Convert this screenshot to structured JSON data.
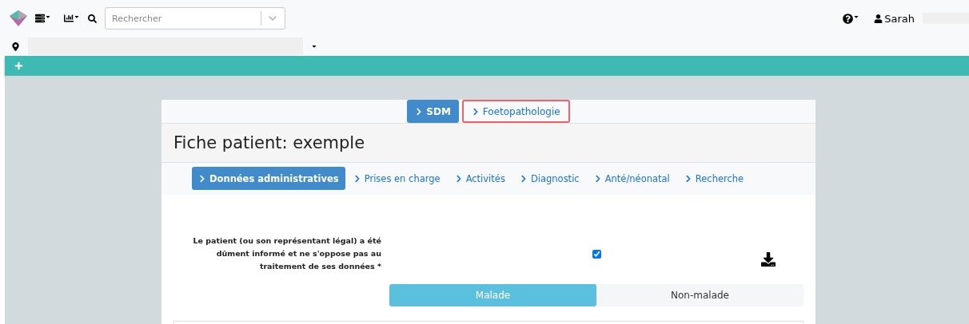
{
  "navbar": {
    "search": {
      "placeholder": "Rechercher"
    },
    "user": {
      "name": "Sarah"
    }
  },
  "modules": [
    {
      "label": "SDM",
      "selected": true,
      "highlighted": false
    },
    {
      "label": "Foetopathologie",
      "selected": false,
      "highlighted": true
    }
  ],
  "page": {
    "title": "Fiche patient: exemple"
  },
  "tabs": [
    {
      "label": "Données administratives",
      "selected": true
    },
    {
      "label": "Prises en charge",
      "selected": false
    },
    {
      "label": "Activités",
      "selected": false
    },
    {
      "label": "Diagnostic",
      "selected": false
    },
    {
      "label": "Anté/néonatal",
      "selected": false
    },
    {
      "label": "Recherche",
      "selected": false
    }
  ],
  "consent": {
    "label": "Le patient (ou son représentant légal) a été dûment informé et ne s'oppose pas au traitement de ses données *",
    "checked": true
  },
  "status_toggle": [
    {
      "label": "Malade",
      "selected": true
    },
    {
      "label": "Non-malade",
      "selected": false
    }
  ]
}
